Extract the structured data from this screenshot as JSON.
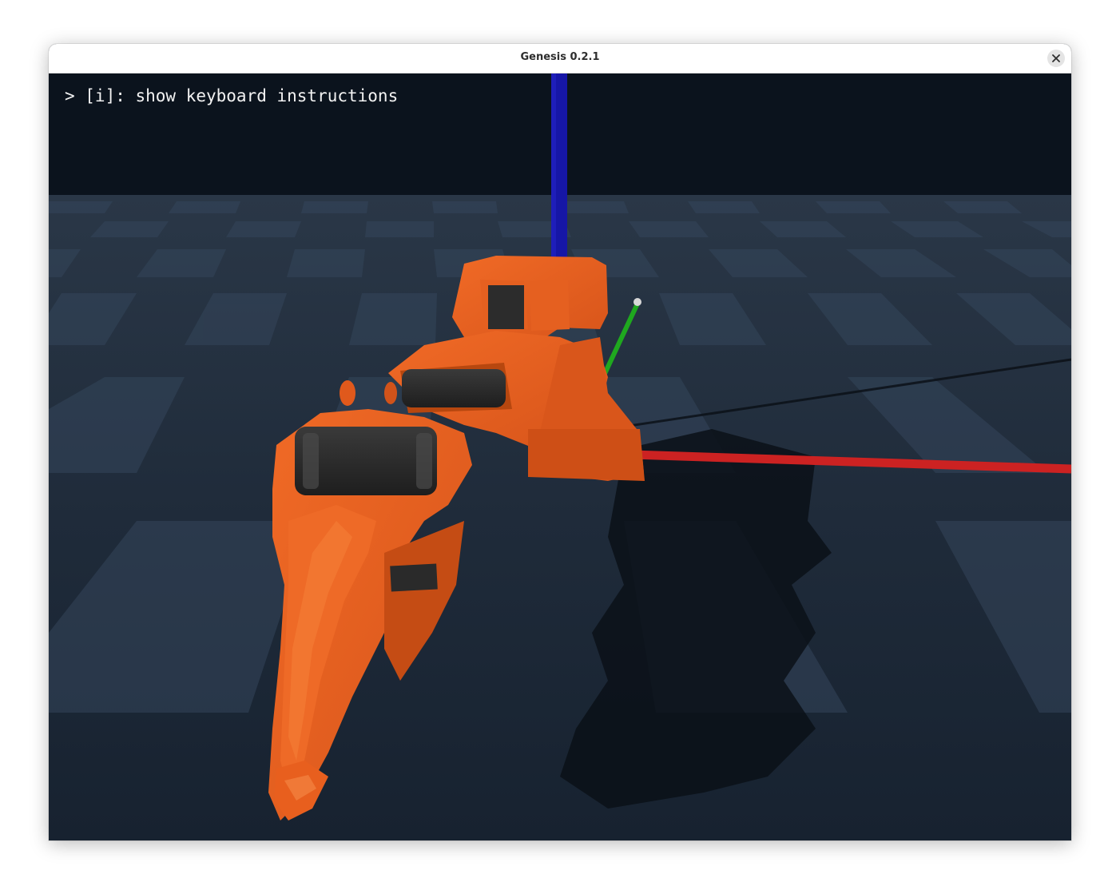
{
  "window": {
    "title": "Genesis 0.2.1"
  },
  "viewer": {
    "overlay_text": "> [i]: show keyboard instructions",
    "colors": {
      "sky": "#0b131d",
      "floor_dark": "#1c2838",
      "floor_light": "#2c3b4e",
      "robot_body": "#e85f1e",
      "robot_shade": "#b0420e",
      "roller": "#2b2b2b",
      "axis_x": "#d42222",
      "axis_y": "#1fa01f",
      "axis_z": "#1a1aa8"
    },
    "icons": {
      "close": "close-icon"
    }
  }
}
